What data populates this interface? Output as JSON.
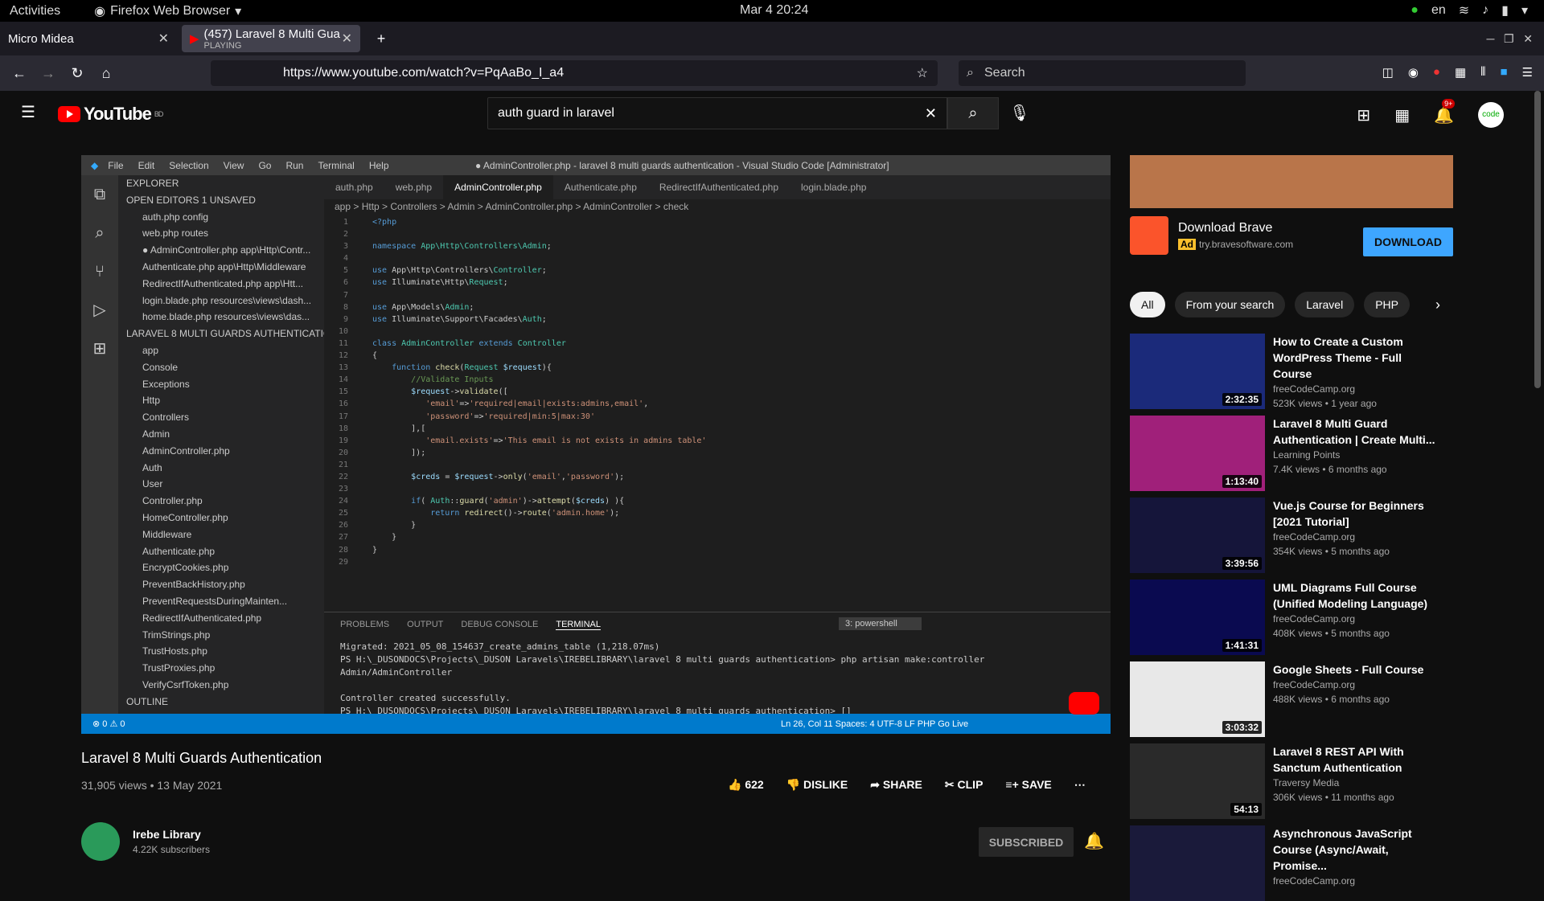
{
  "system": {
    "activities": "Activities",
    "app": "Firefox Web Browser",
    "clock": "Mar 4  20:24",
    "lang": "en"
  },
  "browser": {
    "tabs": [
      {
        "label": "Micro Midea"
      },
      {
        "label": "(457) Laravel 8 Multi Gua",
        "sub": "PLAYING"
      }
    ],
    "url": "https://www.youtube.com/watch?v=PqAaBo_I_a4",
    "search_placeholder": "Search"
  },
  "youtube": {
    "logo": "YouTube",
    "region": "BD",
    "query": "auth guard in laravel",
    "notif": "9+",
    "video": {
      "title": "Laravel 8 Multi Guards Authentication",
      "meta": "31,905 views • 13 May 2021",
      "likes": "622",
      "dislike": "DISLIKE",
      "share": "SHARE",
      "clip": "CLIP",
      "save": "SAVE"
    },
    "channel": {
      "name": "Irebe Library",
      "subs": "4.22K subscribers",
      "button": "SUBSCRIBED"
    },
    "ad": {
      "title": "Download Brave",
      "badge": "Ad",
      "url": "try.bravesoftware.com",
      "button": "DOWNLOAD"
    },
    "chips": [
      "All",
      "From your search",
      "Laravel",
      "PHP"
    ],
    "recs": [
      {
        "title": "How to Create a Custom WordPress Theme - Full Course",
        "channel": "freeCodeCamp.org",
        "views": "523K views • 1 year ago",
        "duration": "2:32:35",
        "color": "#1b2a7a"
      },
      {
        "title": "Laravel 8 Multi Guard Authentication | Create Multi...",
        "channel": "Learning Points",
        "views": "7.4K views • 6 months ago",
        "duration": "1:13:40",
        "color": "#a0207a"
      },
      {
        "title": "Vue.js Course for Beginners [2021 Tutorial]",
        "channel": "freeCodeCamp.org",
        "views": "354K views • 5 months ago",
        "duration": "3:39:56",
        "color": "#15153a"
      },
      {
        "title": "UML Diagrams Full Course (Unified Modeling Language)",
        "channel": "freeCodeCamp.org",
        "views": "408K views • 5 months ago",
        "duration": "1:41:31",
        "color": "#0a0a50"
      },
      {
        "title": "Google Sheets - Full Course",
        "channel": "freeCodeCamp.org",
        "views": "488K views • 6 months ago",
        "duration": "3:03:32",
        "color": "#e8e8e8"
      },
      {
        "title": "Laravel 8 REST API With Sanctum Authentication",
        "channel": "Traversy Media",
        "views": "306K views • 11 months ago",
        "duration": "54:13",
        "color": "#2a2a2a"
      },
      {
        "title": "Asynchronous JavaScript Course (Async/Await, Promise...",
        "channel": "freeCodeCamp.org",
        "views": "",
        "duration": "",
        "color": "#1a1a3a"
      }
    ]
  },
  "vscode": {
    "menu": [
      "File",
      "Edit",
      "Selection",
      "View",
      "Go",
      "Run",
      "Terminal",
      "Help"
    ],
    "title": "● AdminController.php - laravel 8 multi guards authentication - Visual Studio Code [Administrator]",
    "tabs": [
      "auth.php",
      "web.php",
      "AdminController.php",
      "Authenticate.php",
      "RedirectIfAuthenticated.php",
      "login.blade.php"
    ],
    "breadcrumb": "app > Http > Controllers > Admin > AdminController.php > AdminController > check",
    "explorer": [
      "EXPLORER",
      "OPEN EDITORS  1 UNSAVED",
      "auth.php config",
      "web.php routes",
      "● AdminController.php app\\Http\\Contr...",
      "Authenticate.php app\\Http\\Middleware",
      "RedirectIfAuthenticated.php app\\Htt...",
      "login.blade.php resources\\views\\dash...",
      "home.blade.php resources\\views\\das...",
      "LARAVEL 8 MULTI GUARDS AUTHENTICATION",
      "app",
      "Console",
      "Exceptions",
      "Http",
      "Controllers",
      "Admin",
      "AdminController.php",
      "Auth",
      "User",
      "Controller.php",
      "HomeController.php",
      "Middleware",
      "Authenticate.php",
      "EncryptCookies.php",
      "PreventBackHistory.php",
      "PreventRequestsDuringMainten...",
      "RedirectIfAuthenticated.php",
      "TrimStrings.php",
      "TrustHosts.php",
      "TrustProxies.php",
      "VerifyCsrfToken.php",
      "OUTLINE"
    ],
    "panel_tabs": [
      "PROBLEMS",
      "OUTPUT",
      "DEBUG CONSOLE",
      "TERMINAL"
    ],
    "shell": "3: powershell",
    "terminal": [
      "Migrated:  2021_05_08_154637_create_admins_table (1,218.07ms)",
      "PS H:\\_DUSONDOCS\\Projects\\_DUSON Laravels\\IREBELIBRARY\\laravel 8 multi guards authentication> php artisan make:controller Admin/AdminController",
      "",
      "Controller created successfully.",
      "PS H:\\_DUSONDOCS\\Projects\\_DUSON Laravels\\IREBELIBRARY\\laravel 8 multi guards authentication> []"
    ],
    "status_left": "⊗ 0 ⚠ 0",
    "status_right": "Ln 26, Col 11    Spaces: 4    UTF-8    LF    PHP    Go Live"
  }
}
